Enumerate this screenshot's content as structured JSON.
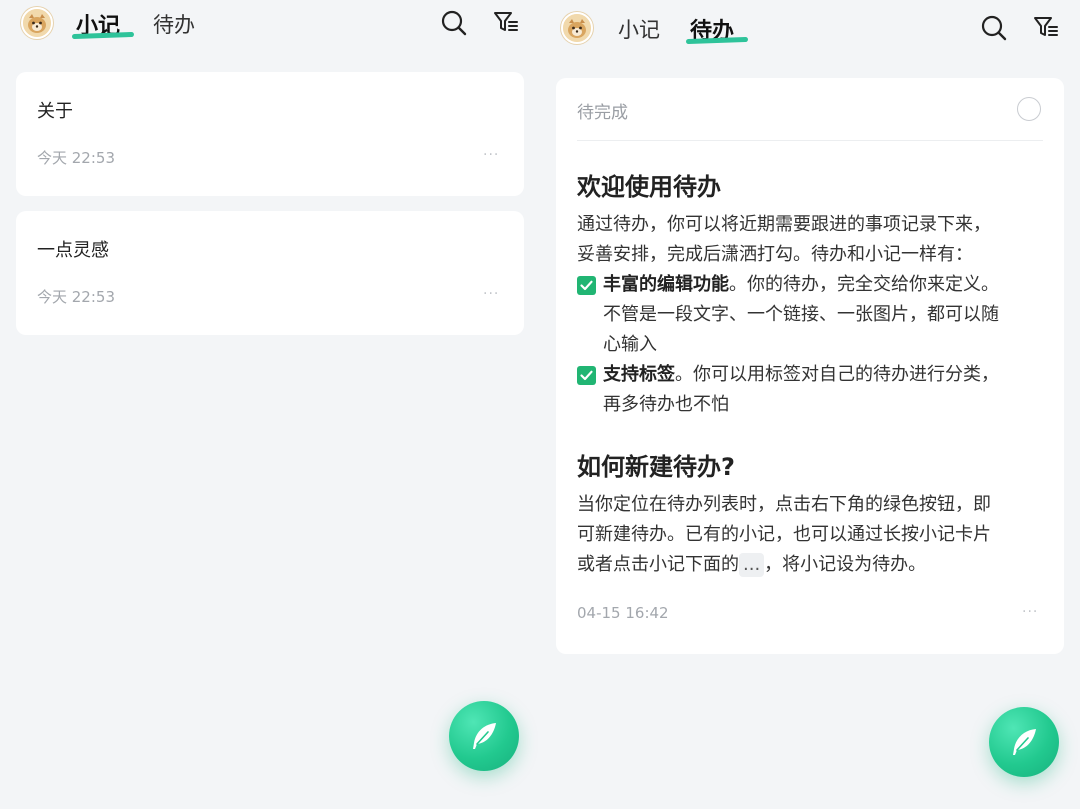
{
  "left_screen": {
    "tabs": [
      {
        "label": "小记",
        "active": true
      },
      {
        "label": "待办",
        "active": false
      }
    ],
    "notes": [
      {
        "title": "关于",
        "time": "今天 22:53",
        "more": "···"
      },
      {
        "title": "一点灵感",
        "time": "今天 22:53",
        "more": "···"
      }
    ]
  },
  "right_screen": {
    "tabs": [
      {
        "label": "小记",
        "active": false
      },
      {
        "label": "待办",
        "active": true
      }
    ],
    "todo_card": {
      "status": "待完成",
      "heading1": "欢迎使用待办",
      "intro_line1": "通过待办，你可以将近期需要跟进的事项记录下来，",
      "intro_line2": "妥善安排，完成后潇洒打勾。待办和小记一样有：",
      "check_items": [
        {
          "bold": "丰富的编辑功能",
          "line1_rest": "。你的待办，完全交给你来定义。",
          "line2": "不管是一段文字、一个链接、一张图片，都可以随",
          "line3": "心输入"
        },
        {
          "bold": "支持标签",
          "line1_rest": "。你可以用标签对自己的待办进行分类，",
          "line2": "再多待办也不怕"
        }
      ],
      "heading2": "如何新建待办?",
      "howto_line1": "当你定位在待办列表时，点击右下角的绿色按钮，即",
      "howto_line2": "可新建待办。已有的小记，也可以通过长按小记卡片",
      "howto_line3_pre": "或者点击小记下面的",
      "howto_chip": "...",
      "howto_line3_post": "，将小记设为待办。",
      "time": "04-15 16:42",
      "more": "···"
    }
  },
  "colors": {
    "accent_green": "#2ec39a",
    "checkbox_green": "#21b573",
    "background": "#f3f5f7"
  },
  "icons": {
    "search": "search-icon",
    "filter": "filter-icon",
    "fab": "feather-icon"
  }
}
